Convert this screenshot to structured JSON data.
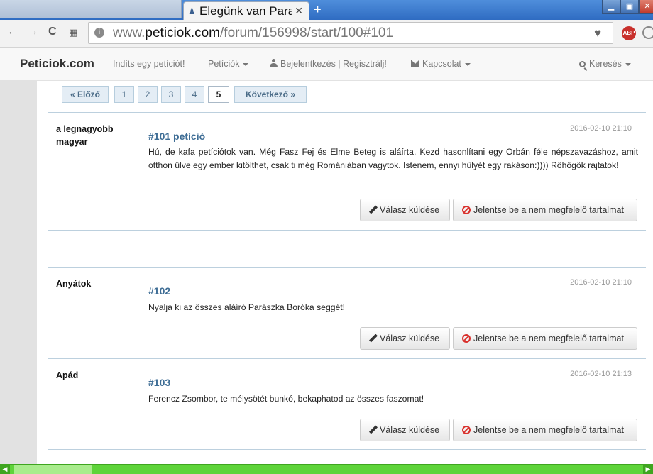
{
  "browser": {
    "active_tab_title": "Elegünk van Para",
    "close_glyph": "✕",
    "new_tab_glyph": "+",
    "url_prefix": "www.",
    "url_domain": "peticiok.com",
    "url_path": "/forum/156998/start/100#101",
    "abp_label": "ABP",
    "window_min": "▁",
    "window_max": "▣",
    "window_close": "✕"
  },
  "navbar": {
    "brand": "Peticiok.com",
    "start_petition": "Indíts egy petíciót!",
    "petitions": "Petíciók",
    "login": "Bejelentkezés | Regisztrálj!",
    "contact": "Kapcsolat",
    "search": "Keresés"
  },
  "pagination": {
    "prev": "« Előző",
    "pages": [
      "1",
      "2",
      "3",
      "4",
      "5"
    ],
    "active_page": "5",
    "next": "Következő »"
  },
  "posts": [
    {
      "author": "a legnagyobb magyar",
      "date": "2016-02-10 21:10",
      "title": "#101 petíció",
      "body": "Hú, de kafa petíciótok van. Még Fasz Fej és Elme Beteg is aláírta. Kezd hasonlítani egy Orbán féle népszavazáshoz, amit otthon ülve egy ember kitölthet, csak ti még Romániában vagytok. Istenem, ennyi hülyét egy rakáson:)))) Röhögök rajtatok!",
      "reply_label": "Válasz küldése",
      "report_label": "Jelentse be a nem megfelelő tartalmat"
    },
    {
      "author": "Anyátok",
      "date": "2016-02-10 21:10",
      "title": "#102",
      "body": "Nyalja ki az összes aláíró Parászka Boróka seggét!",
      "reply_label": "Válasz küldése",
      "report_label": "Jelentse be a nem megfelelő tartalmat"
    },
    {
      "author": "Apád",
      "date": "2016-02-10 21:13",
      "title": "#103",
      "body": "Ferencz Zsombor, te mélysötét bunkó, bekaphatod az összes faszomat!",
      "reply_label": "Válasz küldése",
      "report_label": "Jelentse be a nem megfelelő tartalmat"
    }
  ],
  "colors": {
    "link_blue": "#3e6d95",
    "separator": "#bcd0de",
    "report_red": "#d9302c",
    "scrollbar_green": "#5ed43a"
  },
  "icons": {
    "back": "arrow-left-icon",
    "forward": "arrow-right-icon",
    "reload": "reload-icon",
    "apps": "apps-grid-icon",
    "bookmark": "heart-icon",
    "reply": "pencil-icon",
    "report": "ban-icon",
    "search": "magnifier-icon"
  }
}
